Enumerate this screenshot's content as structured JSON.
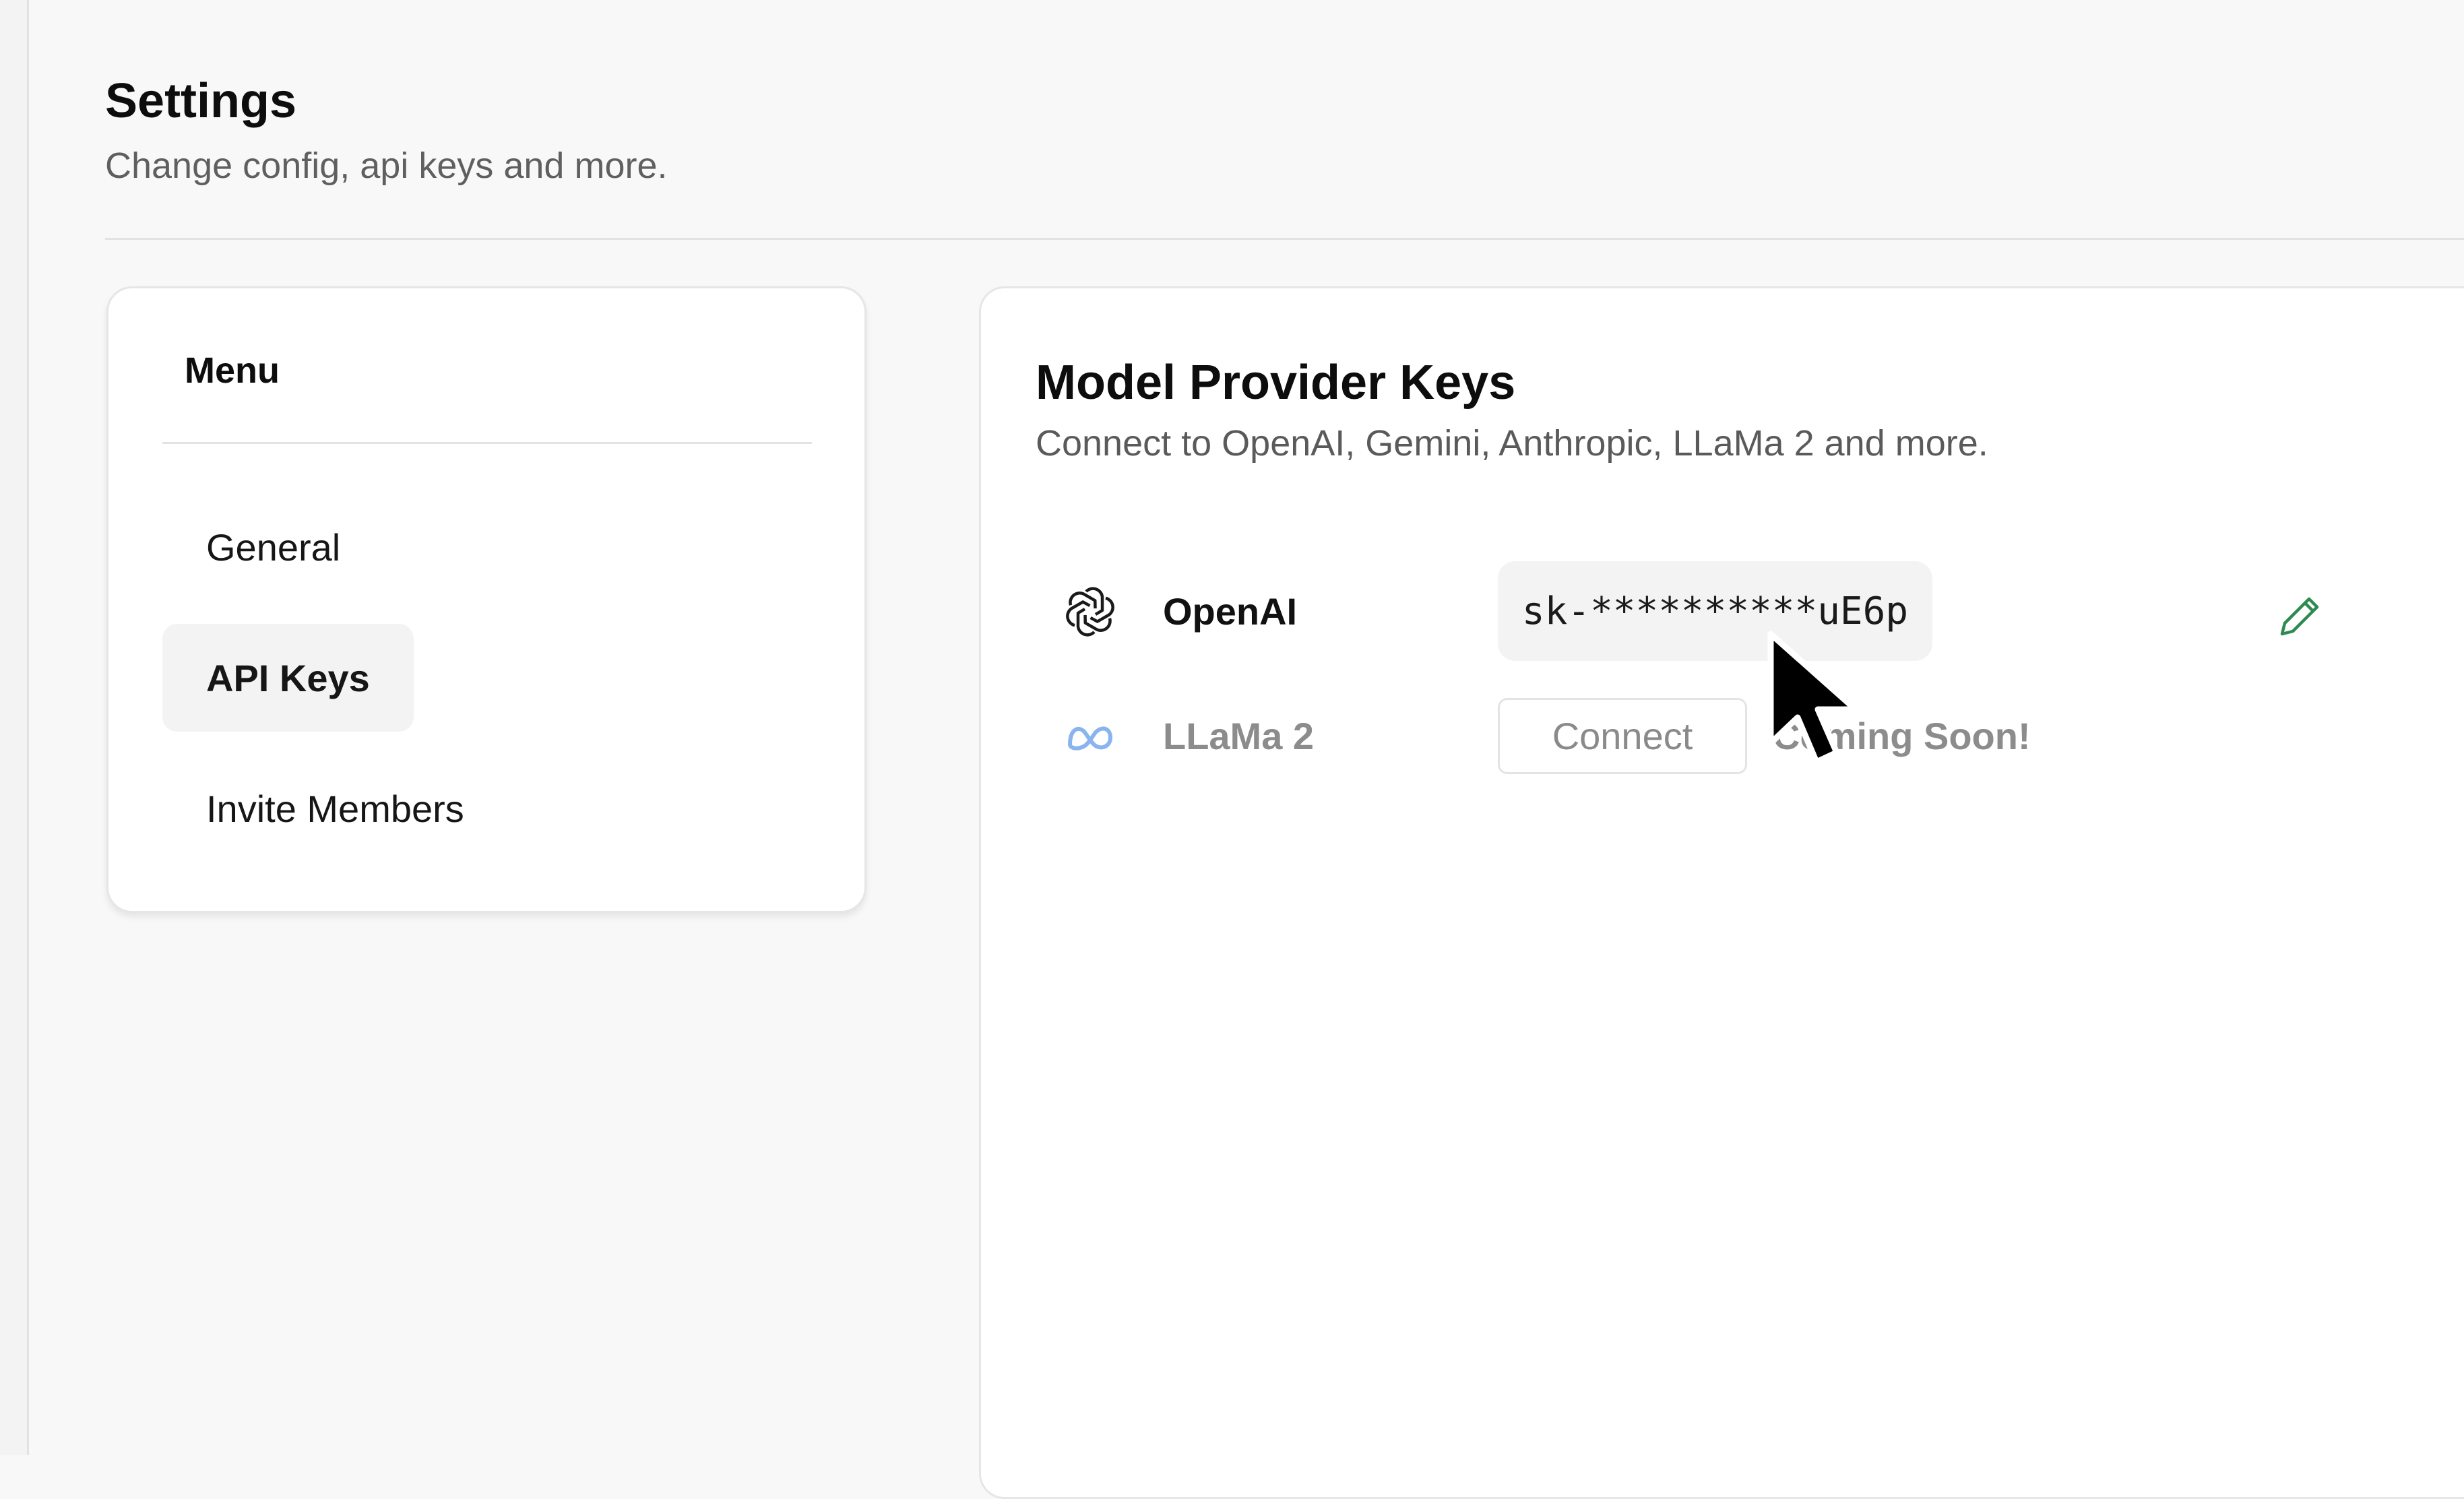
{
  "header": {
    "title": "Settings",
    "subtitle": "Change config, api keys and more."
  },
  "menu": {
    "title": "Menu",
    "items": [
      {
        "label": "General",
        "active": false
      },
      {
        "label": "API Keys",
        "active": true
      },
      {
        "label": "Invite Members",
        "active": false
      }
    ]
  },
  "main": {
    "title": "Model Provider Keys",
    "subtitle": "Connect to OpenAI, Gemini, Anthropic, LLaMa 2 and more.",
    "providers": [
      {
        "name": "OpenAI",
        "icon": "openai-logo-icon",
        "key": "sk-**********uE6p",
        "status": "connected"
      },
      {
        "name": "LLaMa 2",
        "icon": "meta-logo-icon",
        "button_label": "Connect",
        "note": "Coming Soon!",
        "status": "disabled"
      }
    ]
  },
  "colors": {
    "background": "#f8f8f8",
    "card": "#ffffff",
    "edit_icon": "#2e8b4f",
    "meta_icon": "#8ab4f0",
    "muted_text": "#8c8c8c"
  }
}
